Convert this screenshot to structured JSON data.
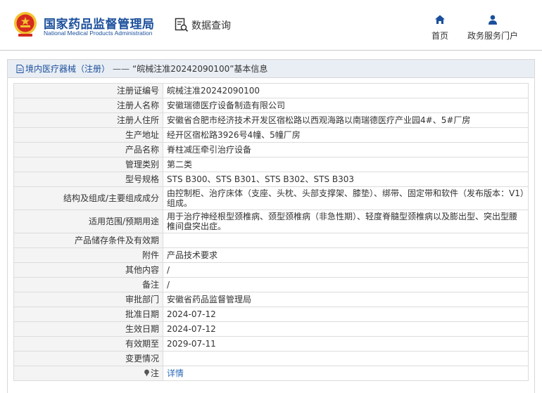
{
  "header": {
    "logo_cn": "国家药品监督管理局",
    "logo_en": "National Medical Products Administration",
    "data_query": "数据查询",
    "nav": [
      {
        "label": "首页",
        "icon": "home-icon"
      },
      {
        "label": "政务服务门户",
        "icon": "user-icon"
      }
    ]
  },
  "panel": {
    "title_prefix": "境内医疗器械（注册）",
    "title_sep": "——",
    "title_main": "“皖械注准20242090100”基本信息"
  },
  "rows": [
    {
      "label": "注册证编号",
      "value": "皖械注准20242090100"
    },
    {
      "label": "注册人名称",
      "value": "安徽瑞德医疗设备制造有限公司"
    },
    {
      "label": "注册人住所",
      "value": "安徽省合肥市经济技术开发区宿松路以西观海路以南瑞德医疗产业园4#、5#厂房"
    },
    {
      "label": "生产地址",
      "value": "经开区宿松路3926号4幢、5幢厂房"
    },
    {
      "label": "产品名称",
      "value": "脊柱减压牵引治疗设备"
    },
    {
      "label": "管理类别",
      "value": "第二类"
    },
    {
      "label": "型号规格",
      "value": "STS B300、STS B301、STS B302、STS B303"
    },
    {
      "label": "结构及组成/主要组成成分",
      "value": "由控制柜、治疗床体（支座、头枕、头部支撑架、膝垫）、绑带、固定带和软件（发布版本：V1）组成。"
    },
    {
      "label": "适用范围/预期用途",
      "value": "用于治疗神经根型颈椎病、颈型颈椎病（非急性期）、轻度脊髓型颈椎病以及膨出型、突出型腰椎间盘突出症。"
    },
    {
      "label": "产品储存条件及有效期",
      "value": ""
    },
    {
      "label": "附件",
      "value": "产品技术要求"
    },
    {
      "label": "其他内容",
      "value": "/"
    },
    {
      "label": "备注",
      "value": "/"
    },
    {
      "label": "审批部门",
      "value": "安徽省药品监督管理局"
    },
    {
      "label": "批准日期",
      "value": "2024-07-12"
    },
    {
      "label": "生效日期",
      "value": "2024-07-12"
    },
    {
      "label": "有效期至",
      "value": "2029-07-11"
    },
    {
      "label": "变更情况",
      "value": ""
    }
  ],
  "note": {
    "label": "注",
    "link": "详情"
  },
  "colors": {
    "brand_blue": "#1b4f9c",
    "link_blue": "#2a6ab8",
    "emblem_red": "#d42a1f",
    "emblem_gold": "#f2c230"
  }
}
